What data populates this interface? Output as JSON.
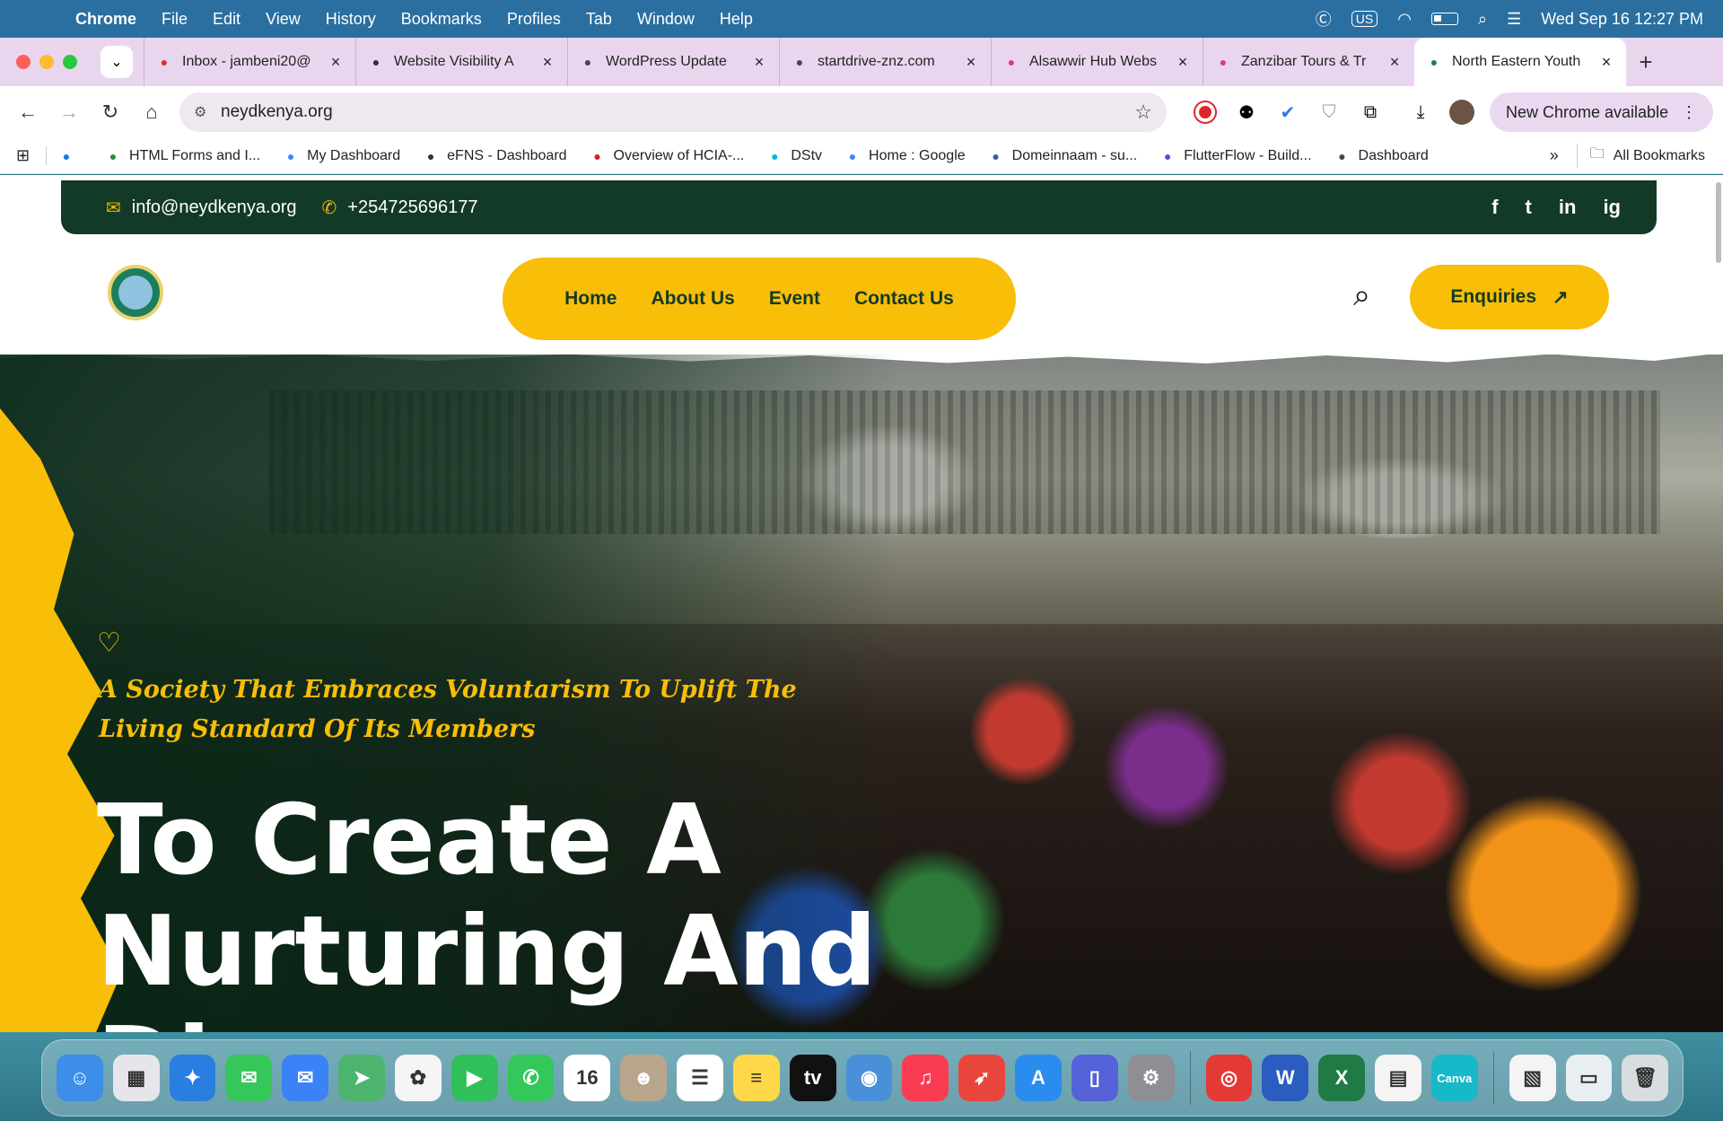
{
  "menubar": {
    "app": "Chrome",
    "items": [
      "File",
      "Edit",
      "View",
      "History",
      "Bookmarks",
      "Profiles",
      "Tab",
      "Window",
      "Help"
    ],
    "input_source": "US",
    "datetime": "Wed Sep 16  12:27 PM"
  },
  "tabs": [
    {
      "title": "Inbox - jambeni20@",
      "icon": "gmail-icon",
      "color": "#d93025"
    },
    {
      "title": "Website Visibility A",
      "icon": "openai-icon",
      "color": "#333333"
    },
    {
      "title": "WordPress Update",
      "icon": "wordpress-site-icon",
      "color": "#444444"
    },
    {
      "title": "startdrive-znz.com",
      "icon": "site-icon",
      "color": "#444444"
    },
    {
      "title": "Alsawwir Hub Webs",
      "icon": "app-icon",
      "color": "#e23a6e"
    },
    {
      "title": "Zanzibar Tours & Tr",
      "icon": "app-icon",
      "color": "#e23a6e"
    },
    {
      "title": "North Eastern Youth",
      "icon": "globe-icon",
      "color": "#1e7d5b"
    }
  ],
  "toolbar": {
    "url": "neydkenya.org",
    "update_label": "New Chrome available"
  },
  "bookmarks": [
    {
      "label": "",
      "icon": "facebook-icon",
      "color": "#1877f2"
    },
    {
      "label": "HTML Forms and I...",
      "icon": "w3-icon",
      "color": "#2b8a3e"
    },
    {
      "label": "My Dashboard",
      "icon": "google-icon",
      "color": "#4285f4"
    },
    {
      "label": "eFNS - Dashboard",
      "icon": "globe-icon",
      "color": "#333333"
    },
    {
      "label": "Overview of HCIA-...",
      "icon": "huawei-icon",
      "color": "#d71e28"
    },
    {
      "label": "DStv",
      "icon": "dstv-icon",
      "color": "#00b7e8"
    },
    {
      "label": "Home : Google",
      "icon": "google-icon",
      "color": "#4285f4"
    },
    {
      "label": "Domeinnaam - su...",
      "icon": "tip-icon",
      "color": "#3a5aa8"
    },
    {
      "label": "FlutterFlow - Build...",
      "icon": "flutterflow-icon",
      "color": "#5b4ce0"
    },
    {
      "label": "Dashboard",
      "icon": "dashboard-icon",
      "color": "#444444"
    }
  ],
  "bookmarks_all": "All Bookmarks",
  "site": {
    "email": "info@neydkenya.org",
    "phone": "+254725696177",
    "socials": [
      "f",
      "t",
      "in",
      "ig"
    ],
    "nav": [
      "Home",
      "About Us",
      "Event",
      "Contact Us"
    ],
    "enquiries": "Enquiries",
    "tagline": "A Society That Embraces Voluntarism To Uplift The Living Standard Of Its Members",
    "hero_title": "To Create A Nurturing And Db..."
  },
  "colors": {
    "brand_green": "#133a26",
    "brand_yellow": "#f8be08"
  },
  "dock": [
    {
      "icon": "finder-icon",
      "color": "#3d8ee8",
      "glyph": "☺"
    },
    {
      "icon": "launchpad-icon",
      "color": "#e6e6ea",
      "glyph": "▦"
    },
    {
      "icon": "safari-icon",
      "color": "#2a7de1",
      "glyph": "✦"
    },
    {
      "icon": "messages-icon",
      "color": "#35c759",
      "glyph": "✉"
    },
    {
      "icon": "mail-icon",
      "color": "#3b82f6",
      "glyph": "✉"
    },
    {
      "icon": "maps-icon",
      "color": "#4db46f",
      "glyph": "➤"
    },
    {
      "icon": "photos-icon",
      "color": "#f5f5f5",
      "glyph": "✿"
    },
    {
      "icon": "facetime-icon",
      "color": "#2fc05a",
      "glyph": "▶"
    },
    {
      "icon": "phone-icon",
      "color": "#34c759",
      "glyph": "✆"
    },
    {
      "icon": "calendar-icon",
      "color": "#ffffff",
      "glyph": "16"
    },
    {
      "icon": "contacts-icon",
      "color": "#b9a58c",
      "glyph": "☻"
    },
    {
      "icon": "reminders-icon",
      "color": "#ffffff",
      "glyph": "☰"
    },
    {
      "icon": "notes-icon",
      "color": "#ffd84a",
      "glyph": "≡"
    },
    {
      "icon": "appletv-icon",
      "color": "#111111",
      "glyph": "tv"
    },
    {
      "icon": "screenshot-icon",
      "color": "#4a90d9",
      "glyph": "◉"
    },
    {
      "icon": "music-icon",
      "color": "#fa3c53",
      "glyph": "♫"
    },
    {
      "icon": "rocket-icon",
      "color": "#e8463c",
      "glyph": "➶"
    },
    {
      "icon": "appstore-icon",
      "color": "#2b8cf0",
      "glyph": "A"
    },
    {
      "icon": "iphone-mirroring-icon",
      "color": "#5562d8",
      "glyph": "▯"
    },
    {
      "icon": "system-settings-icon",
      "color": "#8e8e93",
      "glyph": "⚙"
    },
    {
      "icon": "chrome-icon",
      "color": "#e53935",
      "glyph": "◎"
    },
    {
      "icon": "word-icon",
      "color": "#2b5cc0",
      "glyph": "W"
    },
    {
      "icon": "excel-icon",
      "color": "#1f7a45",
      "glyph": "X"
    },
    {
      "icon": "spreadsheet-icon",
      "color": "#f4f4f4",
      "glyph": "▤"
    },
    {
      "icon": "canva-icon",
      "color": "#17b8c8",
      "glyph": "Canva"
    },
    {
      "icon": "document-icon",
      "color": "#f4f4f4",
      "glyph": "▧"
    },
    {
      "icon": "screen-icon",
      "color": "#e9eef2",
      "glyph": "▭"
    },
    {
      "icon": "trash-icon",
      "color": "#d8dde0",
      "glyph": "🗑"
    }
  ]
}
